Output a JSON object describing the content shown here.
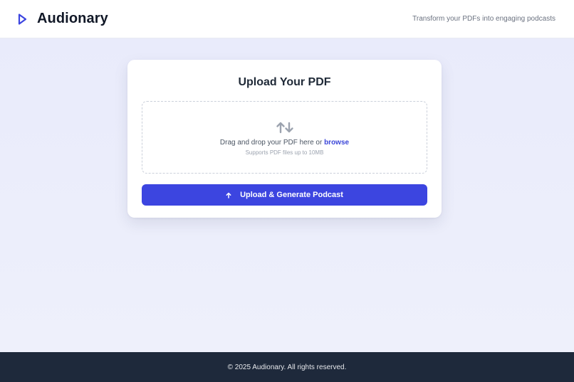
{
  "header": {
    "brand_name": "Audionary",
    "brand_icon": "play-icon",
    "tagline": "Transform your PDFs into engaging podcasts"
  },
  "upload_card": {
    "title": "Upload Your PDF",
    "dropzone": {
      "icon": "upload-download-arrows-icon",
      "prompt_text": "Drag and drop your PDF here or ",
      "browse_label": "browse",
      "hint": "Supports PDF files up to 10MB"
    },
    "submit": {
      "icon": "arrow-up-icon",
      "label": "Upload & Generate Podcast"
    }
  },
  "footer": {
    "copyright": "© 2025 Audionary. All rights reserved."
  },
  "colors": {
    "accent": "#3c45e0",
    "link": "#3b46d8",
    "footer_bg": "#1e293b",
    "page_bg": "#eceefb"
  }
}
